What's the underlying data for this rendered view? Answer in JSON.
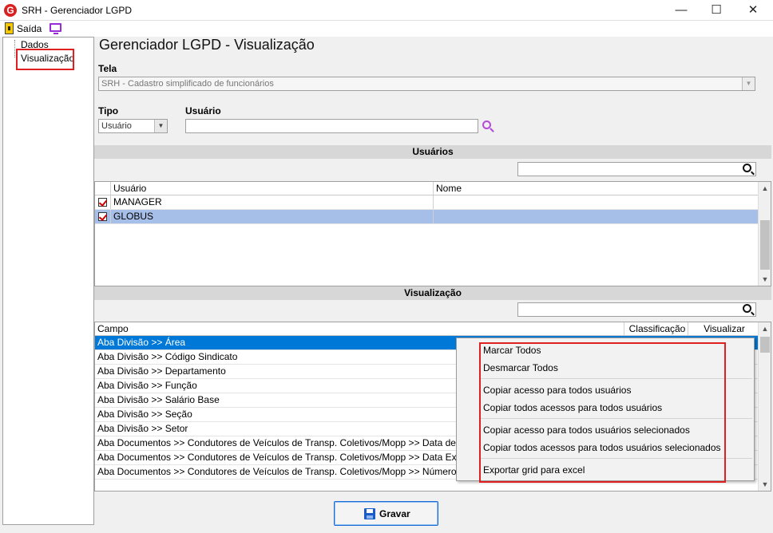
{
  "window": {
    "title": "SRH - Gerenciador LGPD",
    "app_icon": "G",
    "min": "—",
    "max": "☐",
    "close": "✕"
  },
  "menu": {
    "exit_label": "Saída"
  },
  "sidebar": {
    "items": [
      {
        "label": "Dados"
      },
      {
        "label": "Visualização"
      }
    ]
  },
  "page": {
    "title": "Gerenciador LGPD - Visualização"
  },
  "tela": {
    "label": "Tela",
    "value": "SRH - Cadastro simplificado de funcionários"
  },
  "tipo": {
    "label": "Tipo",
    "value": "Usuário"
  },
  "usuario": {
    "label": "Usuário",
    "value": ""
  },
  "usuarios_section": {
    "title": "Usuários",
    "search_value": "",
    "columns": [
      "Usuário",
      "Nome"
    ],
    "rows": [
      {
        "checked": true,
        "user": "MANAGER",
        "name": ""
      },
      {
        "checked": true,
        "user": "GLOBUS",
        "name": ""
      }
    ]
  },
  "visualizacao_section": {
    "title": "Visualização",
    "search_value": "",
    "columns": [
      "Campo",
      "Classificação",
      "Visualizar"
    ],
    "rows": [
      "Aba Divisão >> Área",
      "Aba Divisão >> Código Sindicato",
      "Aba Divisão >> Departamento",
      "Aba Divisão >> Função",
      "Aba Divisão >> Salário Base",
      "Aba Divisão >> Seção",
      "Aba Divisão >> Setor",
      "Aba Documentos >>  Condutores de Veículos de Transp. Coletivos/Mopp >> Data de Vencimento",
      "Aba Documentos >>  Condutores de Veículos de Transp. Coletivos/Mopp >> Data Expedição",
      "Aba Documentos >>  Condutores de Veículos de Transp. Coletivos/Mopp >> Número"
    ]
  },
  "context_menu": {
    "items": [
      "Marcar Todos",
      "Desmarcar Todos",
      "Copiar acesso para todos usuários",
      "Copiar todos acessos para todos usuários",
      "Copiar acesso para todos usuários selecionados",
      "Copiar todos acessos para todos usuários selecionados",
      "Exportar grid para excel"
    ]
  },
  "save_button": {
    "label": "Gravar"
  },
  "colors": {
    "selection": "#0078d7",
    "selected_row": "#a6bfe8",
    "highlight_box": "#e02020"
  }
}
